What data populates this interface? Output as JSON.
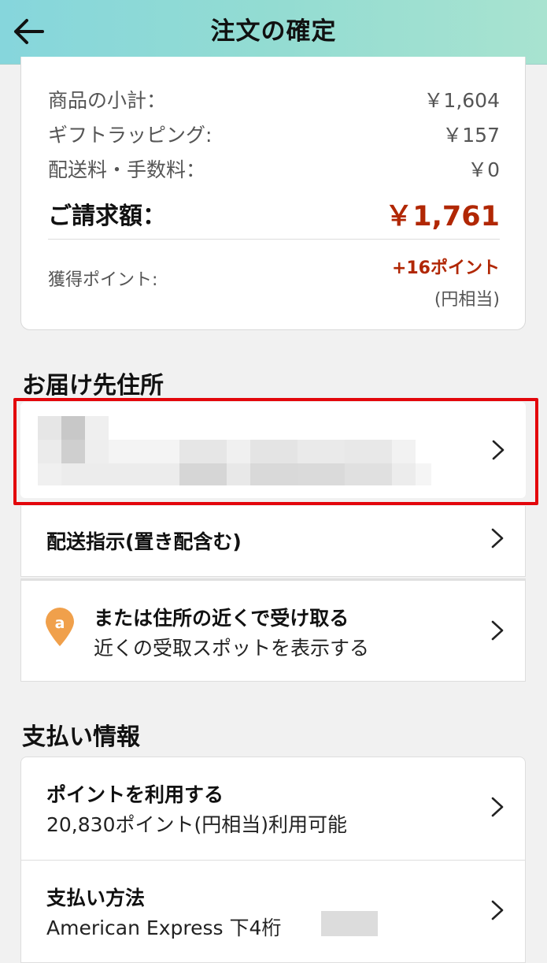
{
  "header": {
    "title": "注文の確定",
    "back_icon": "arrow-left-icon"
  },
  "summary": {
    "subtotal_label": "商品の小計：",
    "subtotal_value": "￥1,604",
    "giftwrap_label": "ギフトラッピング:",
    "giftwrap_value": "￥157",
    "shipping_label": "配送料・手数料：",
    "shipping_value": "￥0",
    "total_label": "ご請求額：",
    "total_value": "￥1,761",
    "points_label": "獲得ポイント:",
    "points_value": "+16ポイント",
    "points_note": "(円相当)"
  },
  "shipping": {
    "heading": "お届け先住所",
    "delivery_instructions": "配送指示(置き配含む)",
    "pickup_title": "または住所の近くで受け取る",
    "pickup_subtitle": "近くの受取スポットを表示する"
  },
  "payment": {
    "heading": "支払い情報",
    "points_title": "ポイントを利用する",
    "points_subtitle": "20,830ポイント(円相当)利用可能",
    "method_title": "支払い方法",
    "method_subtitle": "American Express 下4桁"
  },
  "colors": {
    "accent_price": "#b12704",
    "highlight_border": "#e3060b",
    "header_gradient_start": "#86d6dc",
    "header_gradient_end": "#a8e3d0",
    "pin_orange": "#f0a04b"
  }
}
